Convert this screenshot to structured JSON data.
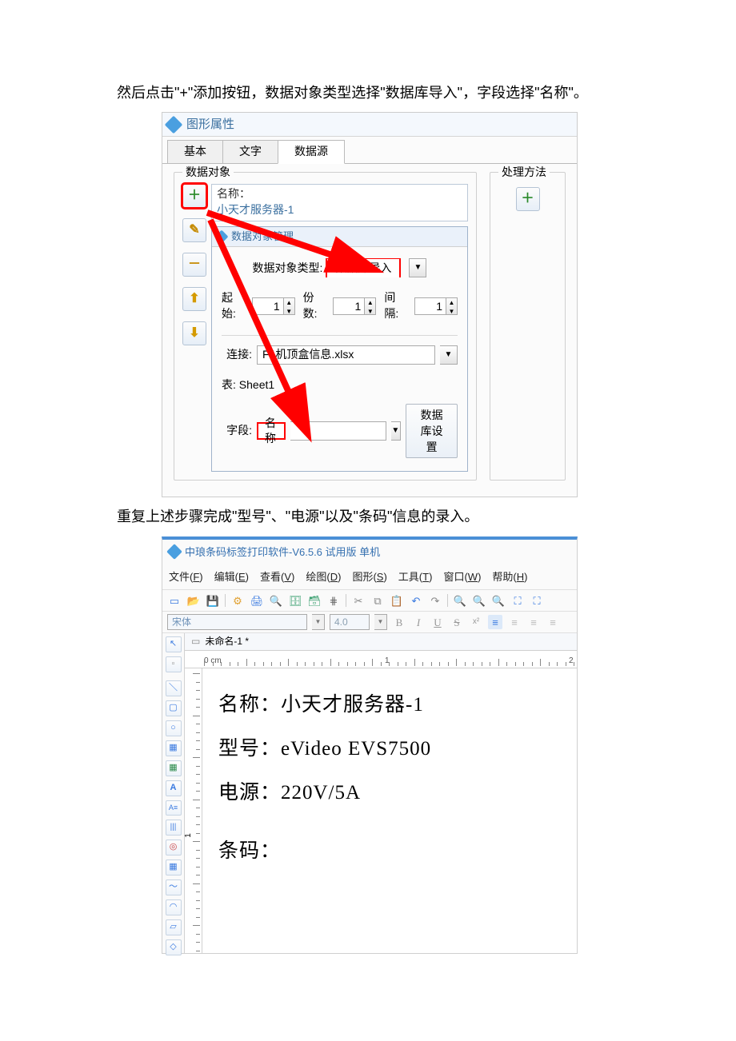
{
  "para1": "然后点击\"+\"添加按钮，数据对象类型选择\"数据库导入\"，字段选择\"名称\"。",
  "dialog1": {
    "title": "图形属性",
    "tabs": [
      "基本",
      "文字",
      "数据源"
    ],
    "active_tab_index": 2,
    "group_data_obj": "数据对象",
    "group_proc": "处理方法",
    "name_label": "名称：",
    "name_value": "小天才服务器-1",
    "subdlg_title": "数据对象管理",
    "type_label": "数据对象类型:",
    "type_value": "数据库导入",
    "start_label": "起始:",
    "start_value": "1",
    "copies_label": "份数:",
    "copies_value": "1",
    "interval_label": "间隔:",
    "interval_value": "1",
    "conn_label": "连接:",
    "conn_value": "F:\\机顶盒信息.xlsx",
    "table_label": "表: Sheet1",
    "field_label": "字段:",
    "field_value": "名称",
    "dbsettings_btn": "数据库设置"
  },
  "para2": "重复上述步骤完成\"型号\"、\"电源\"以及\"条码\"信息的录入。",
  "editor": {
    "title": "中琅条码标签打印软件-V6.5.6 试用版 单机",
    "menus": {
      "file": "文件(F)",
      "edit": "编辑(E)",
      "view": "查看(V)",
      "draw": "绘图(D)",
      "graphic": "图形(S)",
      "tool": "工具(T)",
      "window": "窗口(W)",
      "help": "帮助(H)"
    },
    "font_name": "宋体",
    "font_size": "4.0",
    "doc_tab": "未命名-1 *",
    "ruler_unit": "0 cm",
    "ruler_marks": {
      "mark1": "1",
      "mark2": "2"
    },
    "ruler_v_mark": "1",
    "canvas_lines": {
      "l1": "名称：小天才服务器-1",
      "l2": "型号：eVideo EVS7500",
      "l3": "电源：220V/5A",
      "l4": "条码："
    }
  }
}
